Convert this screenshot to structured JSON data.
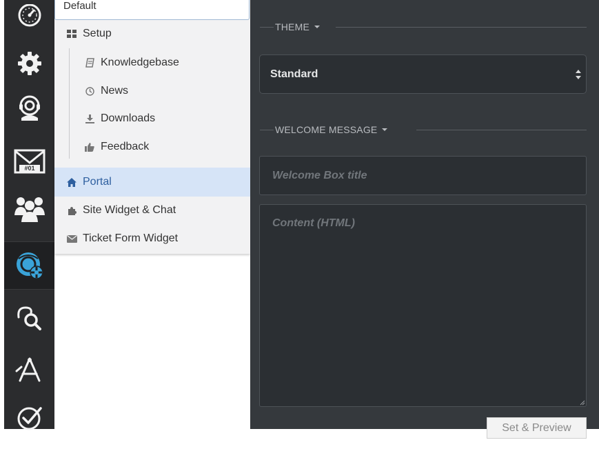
{
  "rail": {
    "items": [
      {
        "icon": "dashboard-gauge-icon"
      },
      {
        "icon": "settings-gear-icon"
      },
      {
        "icon": "support-headset-icon"
      },
      {
        "icon": "ticket-mail-icon",
        "badge": "#01"
      },
      {
        "icon": "users-group-icon"
      },
      {
        "icon": "channels-settings-icon"
      },
      {
        "icon": "search-conversations-icon"
      },
      {
        "icon": "compass-tools-icon"
      },
      {
        "icon": "tasks-check-icon"
      }
    ],
    "active_index": 5
  },
  "subnav": {
    "default_value": "Default",
    "items": [
      {
        "label": "Setup",
        "icon": "grid-icon",
        "level": 0
      },
      {
        "label": "Knowledgebase",
        "icon": "book-icon",
        "level": 1
      },
      {
        "label": "News",
        "icon": "clock-icon",
        "level": 1
      },
      {
        "label": "Downloads",
        "icon": "download-icon",
        "level": 1
      },
      {
        "label": "Feedback",
        "icon": "thumbs-up-icon",
        "level": 1
      },
      {
        "label": "Portal",
        "icon": "home-icon",
        "level": 0,
        "active": true
      },
      {
        "label": "Site Widget & Chat",
        "icon": "puzzle-icon",
        "level": 0
      },
      {
        "label": "Ticket Form Widget",
        "icon": "envelope-icon",
        "level": 0
      }
    ]
  },
  "main": {
    "theme_label": "THEME",
    "theme_value": "Standard",
    "welcome_label": "WELCOME MESSAGE",
    "title_placeholder": "Welcome Box title",
    "content_placeholder": "Content (HTML)",
    "preview_button": "Set & Preview"
  },
  "colors": {
    "rail_bg": "#2b2c2e",
    "accent_blue": "#3aa3d8",
    "main_bg": "#35393d",
    "active_row": "#d6e4f7",
    "active_text": "#2e5f9f"
  }
}
